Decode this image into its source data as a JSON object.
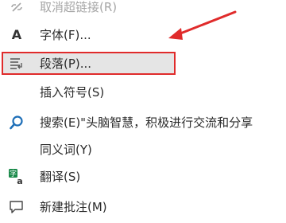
{
  "menu": {
    "items": [
      {
        "label": "取消超链接(R)",
        "disabled": true,
        "icon": "unlink-icon"
      },
      {
        "label": "字体(F)...",
        "disabled": false,
        "icon": "font-icon",
        "icon_glyph": "A"
      },
      {
        "label": "段落(P)...",
        "disabled": false,
        "icon": "paragraph-icon",
        "highlighted": true
      },
      {
        "label": "插入符号(S)",
        "disabled": false,
        "icon": ""
      },
      {
        "label": "搜索(E)\"头脑智慧，积极进行交流和分享",
        "disabled": false,
        "icon": "search-icon"
      },
      {
        "label": "同义词(Y)",
        "disabled": false,
        "icon": ""
      },
      {
        "label": "翻译(S)",
        "disabled": false,
        "icon": "translate-icon"
      },
      {
        "label": "新建批注(M)",
        "disabled": false,
        "icon": "comment-icon"
      }
    ]
  },
  "colors": {
    "highlight_border": "#e02b2b",
    "highlight_bg": "#e5e5e5",
    "arrow": "#e02b2b",
    "search_icon": "#1e6fb8",
    "translate_icon": "#1a8a4a"
  }
}
